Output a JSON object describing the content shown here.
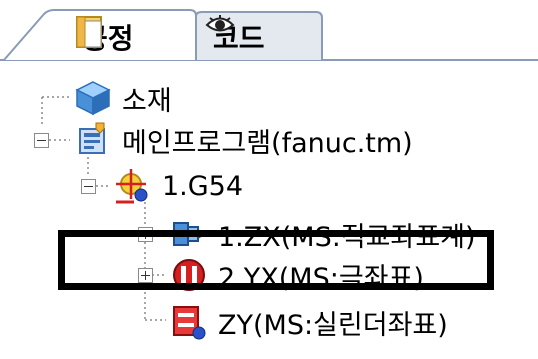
{
  "tabs": [
    {
      "label": "공정",
      "icon": "process-document-icon",
      "active": true
    },
    {
      "label": "코드",
      "icon": "eye-icon",
      "active": false
    }
  ],
  "tree": {
    "material": {
      "label": "소재",
      "icon": "cube-icon"
    },
    "main_program": {
      "label": "메인프로그램(fanuc.tm)",
      "icon": "program-icon",
      "expanded": true
    },
    "g54": {
      "label": "1.G54",
      "icon": "coordinate-origin-icon",
      "expanded": true
    },
    "children": [
      {
        "label": "1.ZX(MS:직교좌표계)",
        "icon": "cartesian-axis-icon",
        "expanded": false
      },
      {
        "label": "2.YX(MS:극좌표)",
        "icon": "polar-axis-icon",
        "expanded": false
      },
      {
        "label": "ZY(MS:실린더좌표)",
        "icon": "cylinder-axis-icon",
        "highlighted": true
      }
    ]
  },
  "colors": {
    "tab_border": "#8a9bb5",
    "tab_active_bg": "#ffffff",
    "tab_inactive_bg": "#e4e8ef",
    "highlight_border": "#000000",
    "cube_blue": "#4a90d9",
    "program_blue": "#3a6fb5",
    "red": "#d42020"
  }
}
